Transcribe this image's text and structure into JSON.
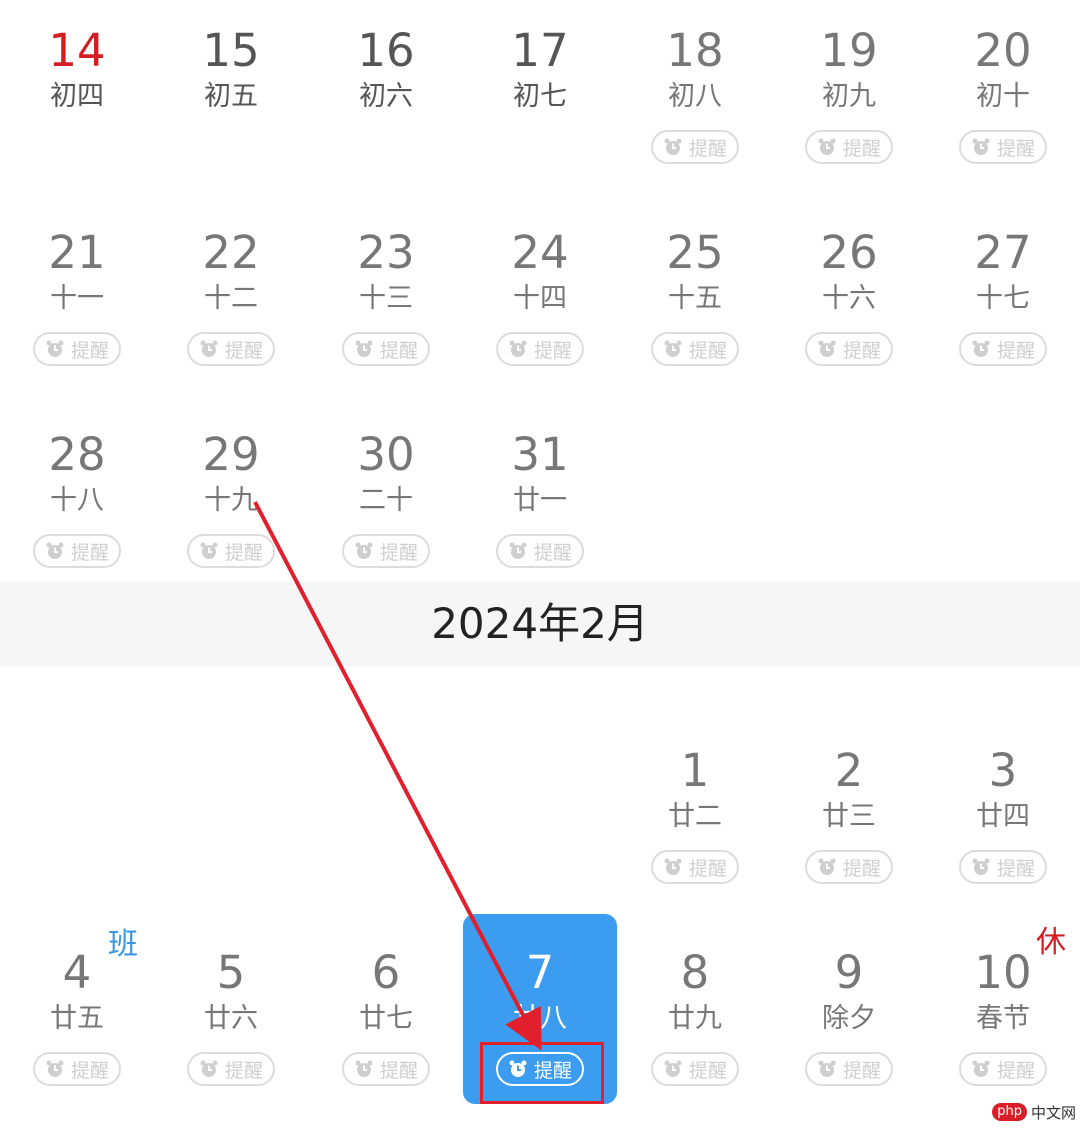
{
  "remind_label": "提醒",
  "colors": {
    "accent": "#3b9cf0",
    "holiday_red": "#d61d24",
    "work_blue": "#3b96e3",
    "annotation_red": "#e0202d"
  },
  "month_title": "2024年2月",
  "january": {
    "row1": [
      {
        "day": "14",
        "lunar": "初四"
      },
      {
        "day": "15",
        "lunar": "初五"
      },
      {
        "day": "16",
        "lunar": "初六"
      },
      {
        "day": "17",
        "lunar": "初七"
      },
      {
        "day": "18",
        "lunar": "初八"
      },
      {
        "day": "19",
        "lunar": "初九"
      },
      {
        "day": "20",
        "lunar": "初十"
      }
    ],
    "row2": [
      {
        "day": "21",
        "lunar": "十一"
      },
      {
        "day": "22",
        "lunar": "十二"
      },
      {
        "day": "23",
        "lunar": "十三"
      },
      {
        "day": "24",
        "lunar": "十四"
      },
      {
        "day": "25",
        "lunar": "十五"
      },
      {
        "day": "26",
        "lunar": "十六"
      },
      {
        "day": "27",
        "lunar": "十七"
      }
    ],
    "row3": [
      {
        "day": "28",
        "lunar": "十八"
      },
      {
        "day": "29",
        "lunar": "十九"
      },
      {
        "day": "30",
        "lunar": "二十"
      },
      {
        "day": "31",
        "lunar": "廿一"
      }
    ]
  },
  "february": {
    "row1": [
      {
        "day": "1",
        "lunar": "廿二"
      },
      {
        "day": "2",
        "lunar": "廿三"
      },
      {
        "day": "3",
        "lunar": "廿四"
      }
    ],
    "row2": [
      {
        "day": "4",
        "lunar": "廿五",
        "tag": "班"
      },
      {
        "day": "5",
        "lunar": "廿六"
      },
      {
        "day": "6",
        "lunar": "廿七"
      },
      {
        "day": "7",
        "lunar": "廿八",
        "selected": true
      },
      {
        "day": "8",
        "lunar": "廿九"
      },
      {
        "day": "9",
        "lunar": "除夕"
      },
      {
        "day": "10",
        "lunar": "春节",
        "tag": "休"
      }
    ]
  },
  "watermark": {
    "badge": "php",
    "text": "中文网"
  }
}
